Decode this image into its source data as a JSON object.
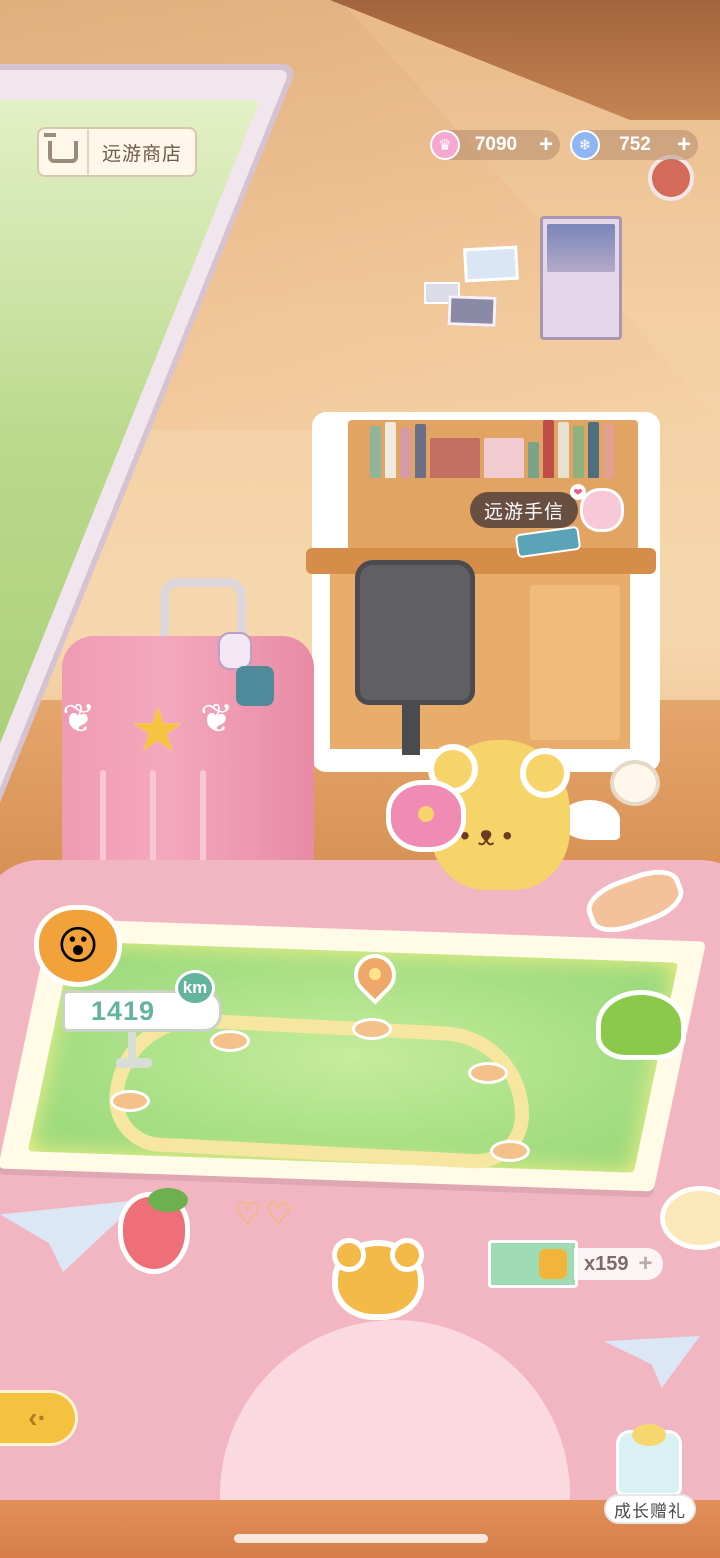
{
  "top_bar": {
    "shop": {
      "label": "远游商店",
      "icon": "shop-cart-icon"
    },
    "currencies": [
      {
        "name": "pink-gem",
        "icon": "pink-gem-icon",
        "value": "7090",
        "plus": "+",
        "color": "#f5a8cf"
      },
      {
        "name": "blue-gem",
        "icon": "snowflake-gem-icon",
        "value": "752",
        "plus": "+",
        "color": "#8fb6f2"
      }
    ]
  },
  "desk": {
    "bubble_label": "远游手信",
    "heart": "❤"
  },
  "map": {
    "distance": "1419",
    "unit": "km",
    "pin_icon": "location-pin-icon"
  },
  "tickets": {
    "count": "x159",
    "plus": "+",
    "icon": "train-ticket-icon"
  },
  "back_button": {
    "icon": "back-arrow-icon",
    "glyph": "‹·"
  },
  "growth_gift": {
    "label": "成长赠礼",
    "icon": "gift-cake-icon"
  },
  "colors": {
    "accent_green": "#64b39d",
    "accent_yellow": "#f4c23e",
    "bed_pink": "#f2b6c2"
  }
}
